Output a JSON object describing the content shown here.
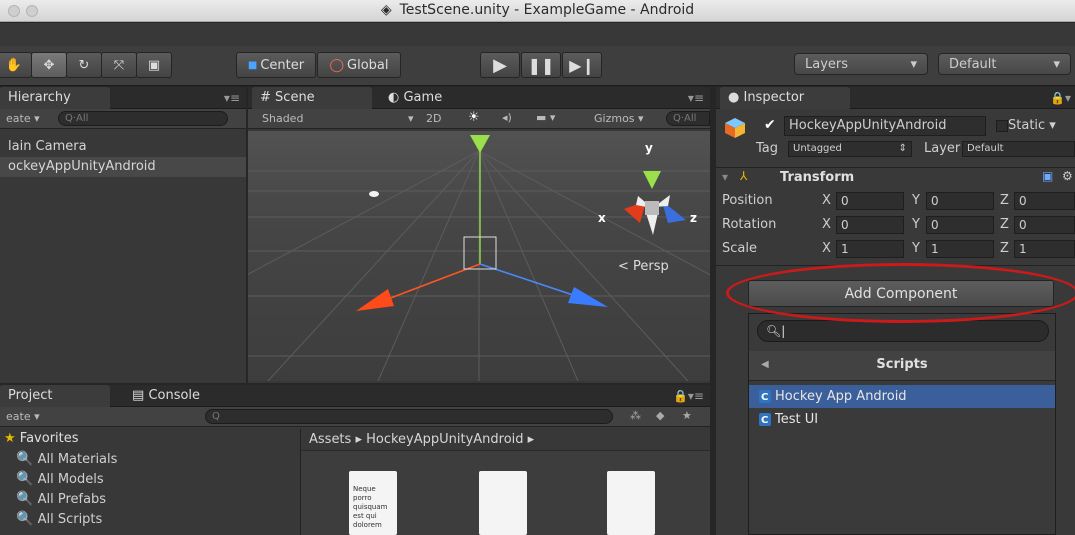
{
  "window": {
    "title": "TestScene.unity - ExampleGame - Android"
  },
  "toolbar": {
    "pivot_center": "Center",
    "pivot_global": "Global",
    "layers": "Layers",
    "layout": "Default"
  },
  "hierarchy": {
    "tab": "Hierarchy",
    "create": "eate",
    "search_placeholder": "Q·All",
    "items": [
      "lain Camera",
      "ockeyAppUnityAndroid"
    ]
  },
  "scene": {
    "tab_scene": "Scene",
    "tab_game": "Game",
    "shading": "Shaded",
    "mode_2d": "2D",
    "gizmos": "Gizmos",
    "search_placeholder": "Q·All",
    "axis_y": "y",
    "axis_x": "x",
    "axis_z": "z",
    "persp": "Persp"
  },
  "project": {
    "tab_project": "Project",
    "tab_console": "Console",
    "create": "eate",
    "favorites_header": "Favorites",
    "favorites": [
      "All Materials",
      "All Models",
      "All Prefabs",
      "All Scripts"
    ],
    "breadcrumb": "Assets ▸ HockeyAppUnityAndroid ▸",
    "asset_preview_text": "Neque porro quisquam est qui dolorem"
  },
  "inspector": {
    "tab": "Inspector",
    "object_name": "HockeyAppUnityAndroid",
    "static_label": "Static",
    "tag_label": "Tag",
    "tag_value": "Untagged",
    "layer_label": "Layer",
    "layer_value": "Default",
    "transform_title": "Transform",
    "rows": [
      {
        "label": "Position",
        "x": "0",
        "y": "0",
        "z": "0"
      },
      {
        "label": "Rotation",
        "x": "0",
        "y": "0",
        "z": "0"
      },
      {
        "label": "Scale",
        "x": "1",
        "y": "1",
        "z": "1"
      }
    ],
    "axis_labels": {
      "x": "X",
      "y": "Y",
      "z": "Z"
    },
    "add_component": "Add Component",
    "popup": {
      "search_value": "",
      "category": "Scripts",
      "scripts": [
        "Hockey App Android",
        "Test UI"
      ]
    }
  },
  "colors": {
    "accent_highlight": "#cc1a1a",
    "selection_blue": "#3b5f9b",
    "play_controls": "#d8d8d8"
  }
}
